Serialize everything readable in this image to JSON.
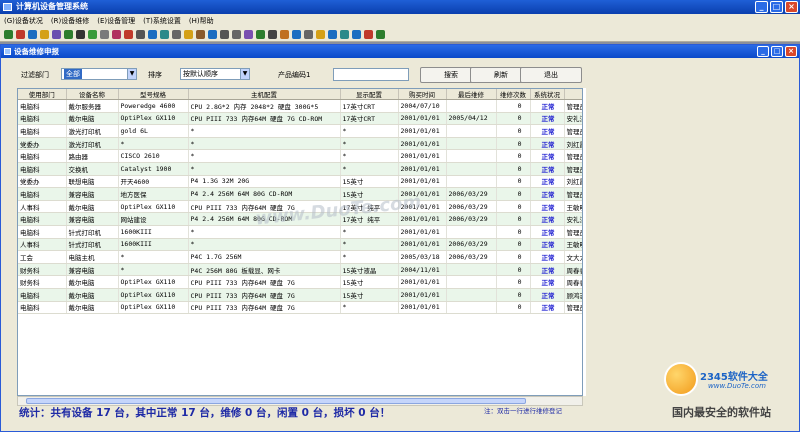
{
  "app": {
    "title": "计算机设备管理系统"
  },
  "menu": [
    "(G)设备状况",
    "(R)设备维修",
    "(E)设备管理",
    "(T)系统设置",
    "(H)帮助"
  ],
  "toolbar": {
    "icons": [
      "refresh-icon",
      "home-icon",
      "arrow-icon",
      "warning-icon",
      "edit-icon",
      "check-icon",
      "cut-icon",
      "green-icon",
      "doc-icon",
      "pen-icon",
      "stop-icon",
      "grid-icon",
      "export-icon",
      "filter-icon",
      "table-icon",
      "circle-icon",
      "tag-icon",
      "tool-icon",
      "lock-icon",
      "wrench-icon",
      "tags-icon",
      "gear-icon",
      "printer-icon",
      "clipboard-icon",
      "search-icon",
      "trash-icon",
      "folder-icon",
      "help-icon",
      "info-icon",
      "monitor-icon",
      "power-icon",
      "exit-icon"
    ]
  },
  "child": {
    "title": "设备维修申报"
  },
  "filter": {
    "dept_label": "过滤部门",
    "dept_value": "全部",
    "sort_label": "排序",
    "sort_value": "按默认顺序",
    "code_label": "产品编码1",
    "code_value": "",
    "search_label": "搜索",
    "refresh_label": "刷新",
    "exit_label": "退出"
  },
  "table": {
    "headers": [
      "使用部门",
      "设备名称",
      "型号规格",
      "主机配置",
      "显示配置",
      "购买时间",
      "最后维修",
      "维修次数",
      "系统状况",
      "责任人"
    ],
    "rows": [
      [
        "电脑科",
        "戴尔服务器",
        "Poweredge 4600",
        "CPU 2.8G*2 内存 2048*2 硬盘 300G*5",
        "17英寸CRT",
        "2004/07/10",
        "",
        "0",
        "正常",
        "管理员"
      ],
      [
        "电脑科",
        "戴尔电脑",
        "OptiPlex GX110",
        "CPU PIII 733 内存64M 硬盘 7G CD-ROM",
        "17英寸CRT",
        "2001/01/01",
        "2005/04/12",
        "0",
        "正常",
        "安礼江"
      ],
      [
        "电脑科",
        "激光打印机",
        "gold 6L",
        "*",
        "*",
        "2001/01/01",
        "",
        "0",
        "正常",
        "管理员"
      ],
      [
        "党委办",
        "激光打印机",
        "*",
        "*",
        "*",
        "2001/01/01",
        "",
        "0",
        "正常",
        "刘红霞"
      ],
      [
        "电脑科",
        "路由器",
        "CISCO 2610",
        "*",
        "*",
        "2001/01/01",
        "",
        "0",
        "正常",
        "管理员"
      ],
      [
        "电脑科",
        "交换机",
        "Catalyst 1900",
        "*",
        "*",
        "2001/01/01",
        "",
        "0",
        "正常",
        "管理员"
      ],
      [
        "党委办",
        "联想电脑",
        "开天4600",
        "P4 1.3G 32M 20G",
        "15英寸",
        "2001/01/01",
        "",
        "0",
        "正常",
        "刘红霞"
      ],
      [
        "电脑科",
        "兼容电脑",
        "地方医保",
        "P4 2.4 256M 64M 80G CD-ROM",
        "15英寸",
        "2001/01/01",
        "2006/03/29",
        "0",
        "正常",
        "管理员"
      ],
      [
        "人事科",
        "戴尔电脑",
        "OptiPlex GX110",
        "CPU PIII 733 内存64M 硬盘 7G",
        "17英寸 纯平",
        "2001/01/01",
        "2006/03/29",
        "0",
        "正常",
        "王敏明"
      ],
      [
        "电脑科",
        "兼容电脑",
        "网站建设",
        "P4 2.4 256M 64M 80G CD-ROM",
        "17英寸 纯平",
        "2001/01/01",
        "2006/03/29",
        "0",
        "正常",
        "安礼江"
      ],
      [
        "电脑科",
        "针式打印机",
        "1600KIII",
        "*",
        "*",
        "2001/01/01",
        "",
        "0",
        "正常",
        "管理员"
      ],
      [
        "人事科",
        "针式打印机",
        "1600KIII",
        "*",
        "*",
        "2001/01/01",
        "2006/03/29",
        "0",
        "正常",
        "王敏明"
      ],
      [
        "工会",
        "电脑主机",
        "*",
        "P4C 1.7G 256M",
        "*",
        "2005/03/18",
        "2006/03/29",
        "0",
        "正常",
        "文大力"
      ],
      [
        "财务科",
        "兼容电脑",
        "*",
        "P4C 256M 80G 板载显、网卡",
        "15英寸液晶",
        "2004/11/01",
        "",
        "0",
        "正常",
        "周春香"
      ],
      [
        "财务科",
        "戴尔电脑",
        "OptiPlex GX110",
        "CPU PIII 733 内存64M 硬盘 7G",
        "15英寸",
        "2001/01/01",
        "",
        "0",
        "正常",
        "周春香"
      ],
      [
        "电脑科",
        "戴尔电脑",
        "OptiPlex GX110",
        "CPU PIII 733 内存64M 硬盘 7G",
        "15英寸",
        "2001/01/01",
        "",
        "0",
        "正常",
        "顾鸿志"
      ],
      [
        "电脑科",
        "戴尔电脑",
        "OptiPlex GX110",
        "CPU PIII 733 内存64M 硬盘 7G",
        "*",
        "2001/01/01",
        "",
        "0",
        "正常",
        "管理员"
      ]
    ]
  },
  "status": {
    "summary": "统计：共有设备 17 台，其中正常 17 台，维修 0 台，闲置 0 台，损坏 0 台！",
    "note": "注：双击一行进行维修登记"
  },
  "watermark": "www.DuoTe.com",
  "logo": {
    "brand": "2345软件大全",
    "url": "www.DuoTe.com",
    "slogan": "国内最安全的软件站"
  }
}
